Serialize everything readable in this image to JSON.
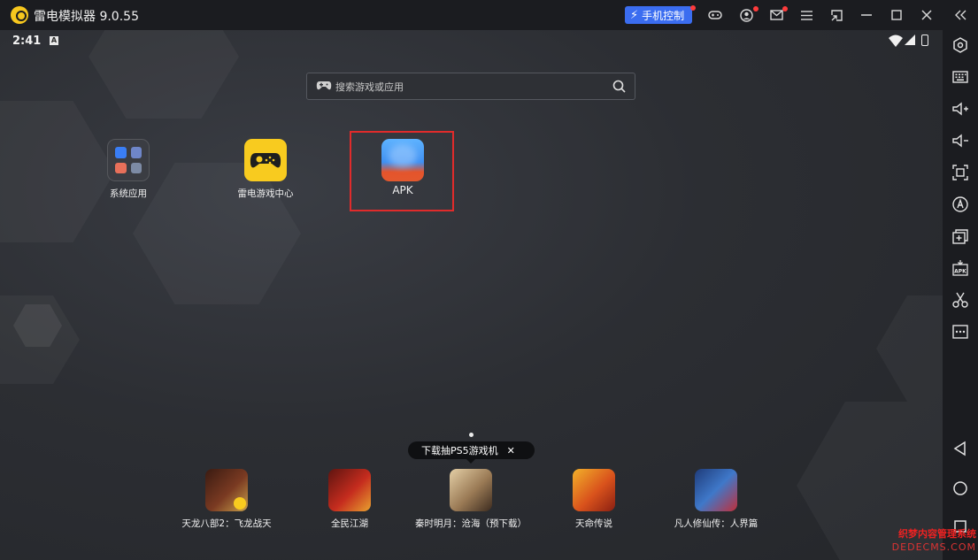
{
  "window": {
    "title": "雷电模拟器 9.0.55",
    "phone_control_label": "手机控制",
    "accent_color": "#3b6df0"
  },
  "statusbar": {
    "time": "2:41",
    "badge": "A"
  },
  "search": {
    "placeholder": "搜索游戏或应用"
  },
  "desktop_apps": [
    {
      "label": "系统应用",
      "icon": "system-apps-folder-icon"
    },
    {
      "label": "雷电游戏中心",
      "icon": "gamepad-icon"
    },
    {
      "label": "APK",
      "icon": "apk-app-icon"
    }
  ],
  "promo": {
    "text": "下载抽PS5游戏机",
    "close": "✕"
  },
  "dock_games": [
    {
      "label": "天龙八部2：飞龙战天",
      "color": "#6b2e1c"
    },
    {
      "label": "全民江湖",
      "color": "#b22a1e"
    },
    {
      "label": "秦时明月：沧海（预下载）",
      "color": "#a88b63"
    },
    {
      "label": "天命传说",
      "color": "#d8571c"
    },
    {
      "label": "凡人修仙传：人界篇",
      "color": "#2f5aa8"
    }
  ],
  "watermark": {
    "line1": "织梦内容管理系统",
    "line2": "DEDECMS.COM"
  },
  "highlight_color": "#e02b2b"
}
